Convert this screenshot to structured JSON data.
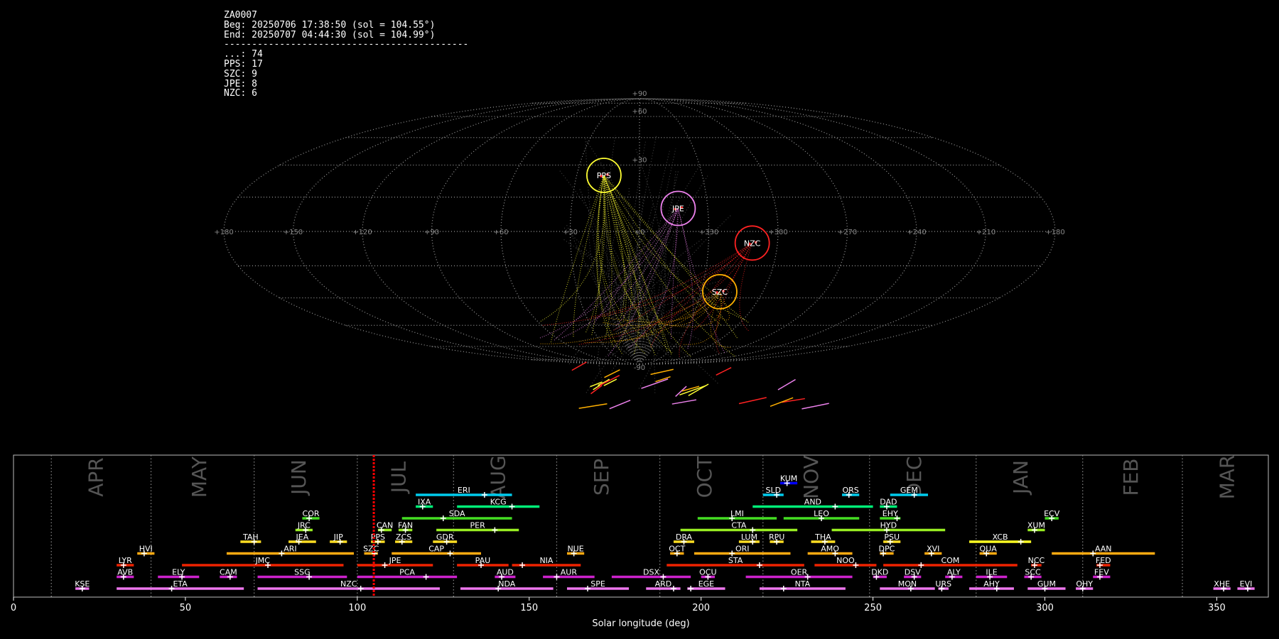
{
  "header": {
    "station": "ZA0007",
    "begin": "Beg: 20250706 17:38:50 (sol = 104.55°)",
    "end": "End: 20250707 04:44:30 (sol = 104.99°)",
    "rule": "--------------------------------------------",
    "counts": [
      {
        "text": "...: 74"
      },
      {
        "text": "PPS: 17"
      },
      {
        "text": "SZC: 9"
      },
      {
        "text": "JPE: 8"
      },
      {
        "text": "NZC: 6"
      }
    ]
  },
  "sky_map": {
    "projection": "sinusoidal",
    "lon_labels": [
      "+180",
      "+150",
      "+120",
      "+90",
      "+60",
      "+30",
      "+0",
      "+330",
      "+300",
      "+270",
      "+240",
      "+210",
      "+180"
    ],
    "lat_labels": [
      "+90",
      "+60",
      "+30",
      "-90"
    ],
    "radiants": [
      {
        "name": "PPS",
        "lon": -17,
        "lat": 25,
        "color": "#ffff33"
      },
      {
        "name": "JPE",
        "lon": 17,
        "lat": 10,
        "color": "#ee82ee"
      },
      {
        "name": "NZC",
        "lon": 49,
        "lat": -5,
        "color": "#ff2222"
      },
      {
        "name": "SZC",
        "lon": 39,
        "lat": -27,
        "color": "#ffb000"
      }
    ]
  },
  "chart_data": {
    "type": "timeline",
    "xlabel": "Solar longitude (deg)",
    "xlim": [
      0,
      365
    ],
    "xticks": [
      0,
      50,
      100,
      150,
      200,
      250,
      300,
      350
    ],
    "current_sol": 104.8,
    "month_boundaries": [
      11,
      40,
      70,
      100,
      128,
      158,
      188,
      218,
      249,
      280,
      311,
      340
    ],
    "months": [
      {
        "label": "APR",
        "sol": 24
      },
      {
        "label": "MAY",
        "sol": 54
      },
      {
        "label": "JUN",
        "sol": 83
      },
      {
        "label": "JUL",
        "sol": 112
      },
      {
        "label": "AUG",
        "sol": 141
      },
      {
        "label": "SEP",
        "sol": 171
      },
      {
        "label": "OCT",
        "sol": 201
      },
      {
        "label": "NOV",
        "sol": 232
      },
      {
        "label": "DEC",
        "sol": 262
      },
      {
        "label": "JAN",
        "sol": 293
      },
      {
        "label": "FEB",
        "sol": 325
      },
      {
        "label": "MAR",
        "sol": 353
      }
    ],
    "showers": [
      {
        "name": "KUM",
        "start": 223,
        "end": 228,
        "peak": 225,
        "row": 9,
        "color": "#0000ff"
      },
      {
        "name": "ERI",
        "start": 117,
        "end": 145,
        "peak": 137,
        "row": 8,
        "color": "#00ccee"
      },
      {
        "name": "SLD",
        "start": 218,
        "end": 224,
        "peak": 222,
        "row": 8,
        "color": "#00ccee"
      },
      {
        "name": "ORS",
        "start": 241,
        "end": 246,
        "peak": 243,
        "row": 8,
        "color": "#00ccee"
      },
      {
        "name": "GEM",
        "start": 255,
        "end": 266,
        "peak": 262,
        "row": 8,
        "color": "#00ccee"
      },
      {
        "name": "IXA",
        "start": 117,
        "end": 122,
        "peak": 119,
        "row": 7,
        "color": "#00ee77"
      },
      {
        "name": "KCG",
        "start": 129,
        "end": 153,
        "peak": 145,
        "row": 7,
        "color": "#00ee77"
      },
      {
        "name": "AND",
        "start": 215,
        "end": 250,
        "peak": 239,
        "row": 7,
        "color": "#00ee77"
      },
      {
        "name": "DAD",
        "start": 252,
        "end": 257,
        "peak": 254,
        "row": 7,
        "color": "#00ee77"
      },
      {
        "name": "COR",
        "start": 84,
        "end": 89,
        "peak": 86,
        "row": 6,
        "color": "#44dd22"
      },
      {
        "name": "SDA",
        "start": 113,
        "end": 145,
        "peak": 125,
        "row": 6,
        "color": "#44dd22"
      },
      {
        "name": "LMI",
        "start": 199,
        "end": 222,
        "peak": 209,
        "row": 6,
        "color": "#44dd22"
      },
      {
        "name": "LEO",
        "start": 224,
        "end": 246,
        "peak": 235,
        "row": 6,
        "color": "#44dd22"
      },
      {
        "name": "EHY",
        "start": 252,
        "end": 258,
        "peak": 257,
        "row": 6,
        "color": "#44dd22"
      },
      {
        "name": "ECV",
        "start": 300,
        "end": 304,
        "peak": 302,
        "row": 6,
        "color": "#44dd22"
      },
      {
        "name": "JRC",
        "start": 82,
        "end": 87,
        "peak": 85,
        "row": 5,
        "color": "#99ee22"
      },
      {
        "name": "CAN",
        "start": 106,
        "end": 110,
        "peak": 107,
        "row": 5,
        "color": "#99ee22"
      },
      {
        "name": "FAN",
        "start": 112,
        "end": 116,
        "peak": 114,
        "row": 5,
        "color": "#99ee22"
      },
      {
        "name": "PER",
        "start": 123,
        "end": 147,
        "peak": 140,
        "row": 5,
        "color": "#99ee22"
      },
      {
        "name": "CTA",
        "start": 194,
        "end": 228,
        "peak": 215,
        "row": 5,
        "color": "#99ee22"
      },
      {
        "name": "HYD",
        "start": 238,
        "end": 271,
        "peak": 254,
        "row": 5,
        "color": "#99ee22"
      },
      {
        "name": "XUM",
        "start": 295,
        "end": 300,
        "peak": 297,
        "row": 5,
        "color": "#99ee22"
      },
      {
        "name": "TAH",
        "start": 66,
        "end": 72,
        "peak": 70,
        "row": 4,
        "color": "#ffdd22"
      },
      {
        "name": "JEA",
        "start": 80,
        "end": 88,
        "peak": 83,
        "row": 4,
        "color": "#ffdd22"
      },
      {
        "name": "JIP",
        "start": 92,
        "end": 97,
        "peak": 95,
        "row": 4,
        "color": "#ffdd22"
      },
      {
        "name": "PPS",
        "start": 104,
        "end": 108,
        "peak": 106,
        "row": 4,
        "color": "#ffdd22"
      },
      {
        "name": "ZCS",
        "start": 111,
        "end": 116,
        "peak": 113,
        "row": 4,
        "color": "#ffdd22"
      },
      {
        "name": "GDR",
        "start": 122,
        "end": 129,
        "peak": 126,
        "row": 4,
        "color": "#ffdd22"
      },
      {
        "name": "DRA",
        "start": 192,
        "end": 198,
        "peak": 195,
        "row": 4,
        "color": "#ffdd22"
      },
      {
        "name": "LUM",
        "start": 211,
        "end": 217,
        "peak": 215,
        "row": 4,
        "color": "#ffdd22"
      },
      {
        "name": "RPU",
        "start": 220,
        "end": 224,
        "peak": 222,
        "row": 4,
        "color": "#ffdd22"
      },
      {
        "name": "THA",
        "start": 232,
        "end": 239,
        "peak": 236,
        "row": 4,
        "color": "#ffdd22"
      },
      {
        "name": "PSU",
        "start": 253,
        "end": 258,
        "peak": 255,
        "row": 4,
        "color": "#ffdd22"
      },
      {
        "name": "XCB",
        "start": 278,
        "end": 296,
        "peak": 293,
        "row": 4,
        "color": "#ffff22"
      },
      {
        "name": "HVI",
        "start": 36,
        "end": 41,
        "peak": 38,
        "row": 3,
        "color": "#ffaa11"
      },
      {
        "name": "ARI",
        "start": 62,
        "end": 99,
        "peak": 78,
        "row": 3,
        "color": "#ffaa11"
      },
      {
        "name": "SZC",
        "start": 102,
        "end": 106,
        "peak": 105,
        "row": 3,
        "color": "#ffaa11"
      },
      {
        "name": "CAP",
        "start": 110,
        "end": 136,
        "peak": 127,
        "row": 3,
        "color": "#ffaa11"
      },
      {
        "name": "NUE",
        "start": 161,
        "end": 166,
        "peak": 163,
        "row": 3,
        "color": "#ffaa11"
      },
      {
        "name": "OCT",
        "start": 191,
        "end": 195,
        "peak": 193,
        "row": 3,
        "color": "#ffaa11"
      },
      {
        "name": "ORI",
        "start": 198,
        "end": 226,
        "peak": 209,
        "row": 3,
        "color": "#ffaa11"
      },
      {
        "name": "AMO",
        "start": 231,
        "end": 244,
        "peak": 239,
        "row": 3,
        "color": "#ffaa11"
      },
      {
        "name": "DPC",
        "start": 252,
        "end": 256,
        "peak": 253,
        "row": 3,
        "color": "#ffaa11"
      },
      {
        "name": "XVI",
        "start": 265,
        "end": 270,
        "peak": 267,
        "row": 3,
        "color": "#ffaa11"
      },
      {
        "name": "QUA",
        "start": 281,
        "end": 286,
        "peak": 283,
        "row": 3,
        "color": "#ffaa11"
      },
      {
        "name": "AAN",
        "start": 302,
        "end": 332,
        "peak": 314,
        "row": 3,
        "color": "#ffaa11"
      },
      {
        "name": "LYR",
        "start": 30,
        "end": 35,
        "peak": 32,
        "row": 2,
        "color": "#ee2200"
      },
      {
        "name": "JMC",
        "start": 49,
        "end": 96,
        "peak": 74,
        "row": 2,
        "color": "#ee2200"
      },
      {
        "name": "JPE",
        "start": 100,
        "end": 122,
        "peak": 108,
        "row": 2,
        "color": "#ee2200"
      },
      {
        "name": "PAU",
        "start": 129,
        "end": 144,
        "peak": 136,
        "row": 2,
        "color": "#ee2200"
      },
      {
        "name": "NIA",
        "start": 145,
        "end": 165,
        "peak": 148,
        "row": 2,
        "color": "#ee2200"
      },
      {
        "name": "STA",
        "start": 190,
        "end": 230,
        "peak": 217,
        "row": 2,
        "color": "#ee2200"
      },
      {
        "name": "NOO",
        "start": 233,
        "end": 251,
        "peak": 245,
        "row": 2,
        "color": "#ee2200"
      },
      {
        "name": "COM",
        "start": 253,
        "end": 292,
        "peak": 264,
        "row": 2,
        "color": "#ee2200"
      },
      {
        "name": "NCC",
        "start": 296,
        "end": 299,
        "peak": 297,
        "row": 2,
        "color": "#ee2200"
      },
      {
        "name": "FED",
        "start": 315,
        "end": 319,
        "peak": 316,
        "row": 2,
        "color": "#ee2200"
      },
      {
        "name": "AVB",
        "start": 30,
        "end": 35,
        "peak": 32,
        "row": 1,
        "color": "#cc22cc"
      },
      {
        "name": "ELY",
        "start": 42,
        "end": 54,
        "peak": 49,
        "row": 1,
        "color": "#cc22cc"
      },
      {
        "name": "CAM",
        "start": 60,
        "end": 65,
        "peak": 63,
        "row": 1,
        "color": "#cc22cc"
      },
      {
        "name": "SSG",
        "start": 71,
        "end": 97,
        "peak": 86,
        "row": 1,
        "color": "#cc22cc"
      },
      {
        "name": "PCA",
        "start": 100,
        "end": 129,
        "peak": 120,
        "row": 1,
        "color": "#cc22cc"
      },
      {
        "name": "AUD",
        "start": 140,
        "end": 146,
        "peak": 142,
        "row": 1,
        "color": "#cc22cc"
      },
      {
        "name": "AUR",
        "start": 154,
        "end": 169,
        "peak": 158,
        "row": 1,
        "color": "#cc22cc"
      },
      {
        "name": "DSX",
        "start": 174,
        "end": 197,
        "peak": 189,
        "row": 1,
        "color": "#cc22cc"
      },
      {
        "name": "OCU",
        "start": 200,
        "end": 204,
        "peak": 202,
        "row": 1,
        "color": "#cc22cc"
      },
      {
        "name": "OER",
        "start": 213,
        "end": 244,
        "peak": 231,
        "row": 1,
        "color": "#cc22cc"
      },
      {
        "name": "DKD",
        "start": 250,
        "end": 254,
        "peak": 251,
        "row": 1,
        "color": "#cc22cc"
      },
      {
        "name": "DSV",
        "start": 259,
        "end": 264,
        "peak": 262,
        "row": 1,
        "color": "#cc22cc"
      },
      {
        "name": "ALY",
        "start": 271,
        "end": 276,
        "peak": 273,
        "row": 1,
        "color": "#cc22cc"
      },
      {
        "name": "ILE",
        "start": 280,
        "end": 289,
        "peak": 284,
        "row": 1,
        "color": "#cc22cc"
      },
      {
        "name": "SCC",
        "start": 294,
        "end": 299,
        "peak": 296,
        "row": 1,
        "color": "#cc22cc"
      },
      {
        "name": "FEV",
        "start": 314,
        "end": 319,
        "peak": 316,
        "row": 1,
        "color": "#cc22cc"
      },
      {
        "name": "KSE",
        "start": 18,
        "end": 22,
        "peak": 20,
        "row": 0,
        "color": "#ee77ee"
      },
      {
        "name": "ETA",
        "start": 30,
        "end": 67,
        "peak": 46,
        "row": 0,
        "color": "#ee77ee"
      },
      {
        "name": "NZC",
        "start": 71,
        "end": 124,
        "peak": 101,
        "row": 0,
        "color": "#ee77ee"
      },
      {
        "name": "NDA",
        "start": 130,
        "end": 157,
        "peak": 141,
        "row": 0,
        "color": "#ee77ee"
      },
      {
        "name": "SPE",
        "start": 161,
        "end": 179,
        "peak": 167,
        "row": 0,
        "color": "#ee77ee"
      },
      {
        "name": "ARD",
        "start": 184,
        "end": 194,
        "peak": 192,
        "row": 0,
        "color": "#ee77ee"
      },
      {
        "name": "EGE",
        "start": 196,
        "end": 207,
        "peak": 197,
        "row": 0,
        "color": "#ee77ee"
      },
      {
        "name": "NTA",
        "start": 217,
        "end": 242,
        "peak": 224,
        "row": 0,
        "color": "#ee77ee"
      },
      {
        "name": "MON",
        "start": 252,
        "end": 268,
        "peak": 261,
        "row": 0,
        "color": "#ee77ee"
      },
      {
        "name": "URS",
        "start": 269,
        "end": 272,
        "peak": 270,
        "row": 0,
        "color": "#ee77ee"
      },
      {
        "name": "AHY",
        "start": 278,
        "end": 291,
        "peak": 286,
        "row": 0,
        "color": "#ee77ee"
      },
      {
        "name": "GUM",
        "start": 295,
        "end": 306,
        "peak": 300,
        "row": 0,
        "color": "#ee77ee"
      },
      {
        "name": "OHY",
        "start": 309,
        "end": 314,
        "peak": 311,
        "row": 0,
        "color": "#ee77ee"
      },
      {
        "name": "XHE",
        "start": 349,
        "end": 354,
        "peak": 352,
        "row": 0,
        "color": "#ee77ee"
      },
      {
        "name": "EVI",
        "start": 356,
        "end": 361,
        "peak": 359,
        "row": 0,
        "color": "#ee77ee"
      }
    ]
  }
}
